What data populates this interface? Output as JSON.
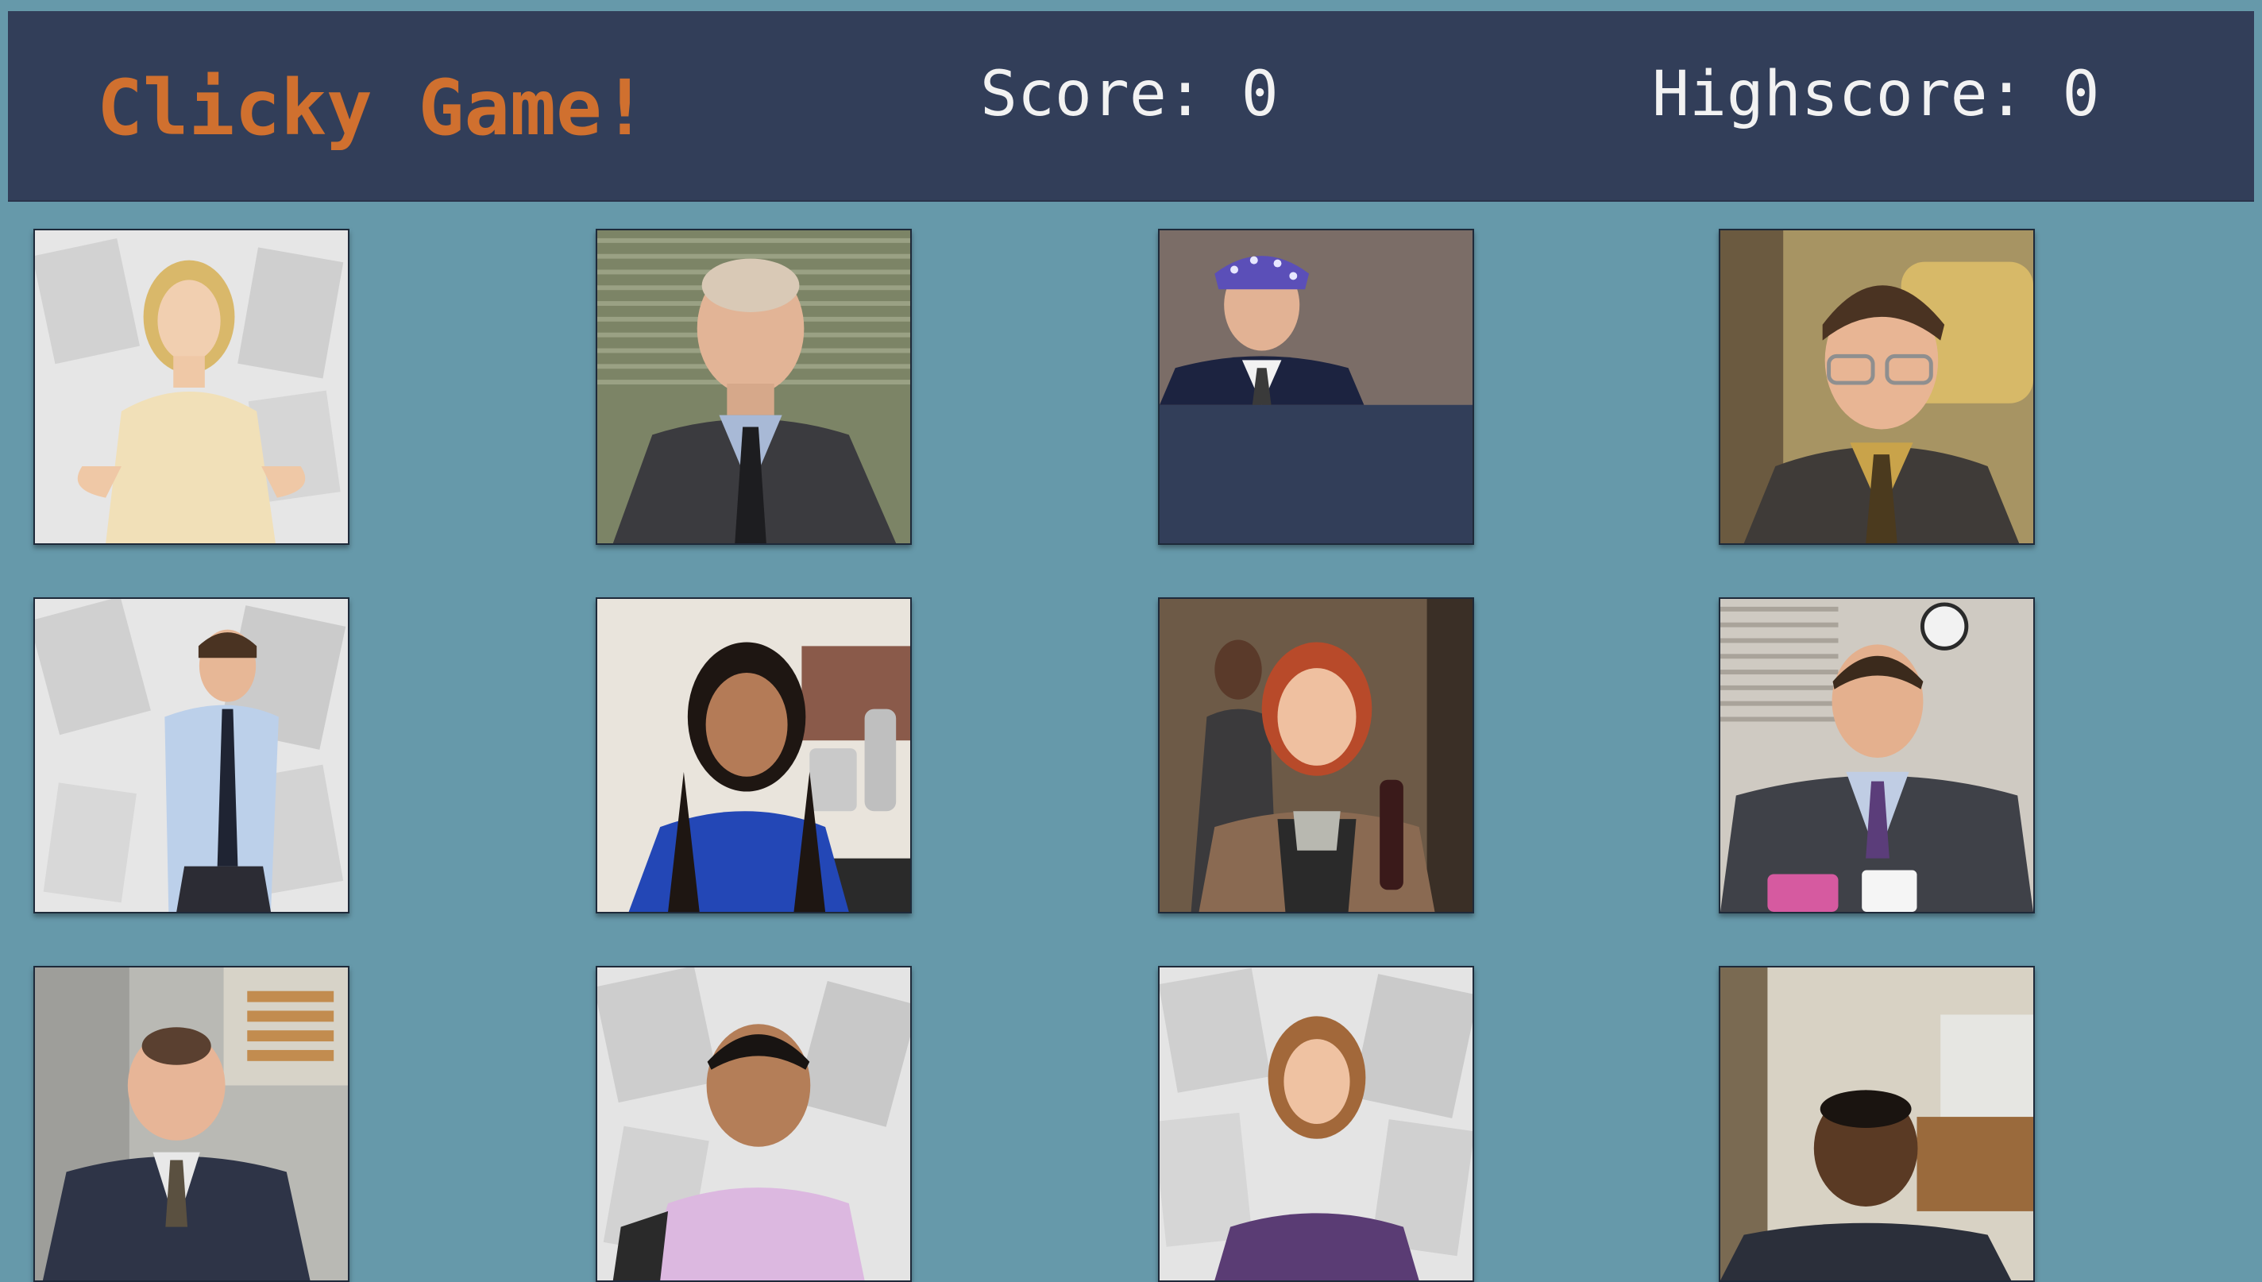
{
  "header": {
    "title": "Clicky Game!",
    "score_label": "Score: 0",
    "highscore_label": "Highscore: 0"
  },
  "colors": {
    "page_background": "#6699aa",
    "navbar_background": "#323e59",
    "title_color": "#d0702f",
    "score_text_color": "#f2f2f2"
  },
  "cards": [
    {
      "name": "card-angela"
    },
    {
      "name": "card-creed"
    },
    {
      "name": "card-prison-mike"
    },
    {
      "name": "card-dwight"
    },
    {
      "name": "card-jim"
    },
    {
      "name": "card-kelly"
    },
    {
      "name": "card-meredith"
    },
    {
      "name": "card-michael"
    },
    {
      "name": "card-kevin"
    },
    {
      "name": "card-oscar"
    },
    {
      "name": "card-pam"
    },
    {
      "name": "card-stanley"
    }
  ]
}
